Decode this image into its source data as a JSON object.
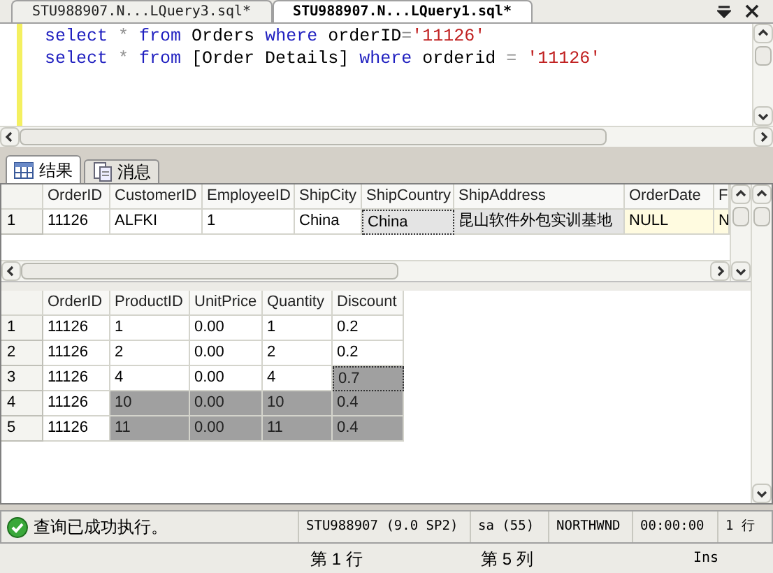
{
  "doc_tabs": [
    {
      "label": "STU988907.N...LQuery3.sql*",
      "selected": false
    },
    {
      "label": "STU988907.N...LQuery1.sql*",
      "selected": true
    }
  ],
  "editor": {
    "lines": [
      [
        {
          "text": "select",
          "kind": "keyword"
        },
        {
          "text": " * ",
          "kind": "operator"
        },
        {
          "text": "from",
          "kind": "keyword"
        },
        {
          "text": " Orders ",
          "kind": "plain"
        },
        {
          "text": "where",
          "kind": "keyword"
        },
        {
          "text": " orderID",
          "kind": "plain"
        },
        {
          "text": "=",
          "kind": "operator"
        },
        {
          "text": "'11126'",
          "kind": "string"
        }
      ],
      [
        {
          "text": "select",
          "kind": "keyword"
        },
        {
          "text": " * ",
          "kind": "operator"
        },
        {
          "text": "from",
          "kind": "keyword"
        },
        {
          "text": " [Order Details] ",
          "kind": "plain"
        },
        {
          "text": "where",
          "kind": "keyword"
        },
        {
          "text": " orderid ",
          "kind": "plain"
        },
        {
          "text": "= ",
          "kind": "operator"
        },
        {
          "text": "'11126'",
          "kind": "string"
        }
      ]
    ]
  },
  "result_tabs": [
    {
      "label": "结果",
      "kind": "grid",
      "selected": true
    },
    {
      "label": "消息",
      "kind": "messages",
      "selected": false
    }
  ],
  "grids": [
    {
      "active": false,
      "columns": [
        "OrderID",
        "CustomerID",
        "EmployeeID",
        "ShipCity",
        "ShipCountry",
        "ShipAddress",
        "OrderDate",
        "F"
      ],
      "rows": [
        {
          "number": "1",
          "cells": [
            {
              "text": "11126",
              "kind": "value",
              "selected": false,
              "focused": false
            },
            {
              "text": "ALFKI",
              "kind": "value",
              "selected": false,
              "focused": false
            },
            {
              "text": "1",
              "kind": "value",
              "selected": false,
              "focused": false
            },
            {
              "text": "China",
              "kind": "value",
              "selected": false,
              "focused": false
            },
            {
              "text": "China",
              "kind": "value",
              "selected": true,
              "focused": true
            },
            {
              "text": "昆山软件外包实训基地",
              "kind": "value",
              "selected": true,
              "focused": false
            },
            {
              "text": "NULL",
              "kind": "null",
              "selected": false,
              "focused": false
            },
            {
              "text": "N",
              "kind": "null",
              "selected": false,
              "focused": false
            }
          ]
        }
      ]
    },
    {
      "active": true,
      "columns": [
        "OrderID",
        "ProductID",
        "UnitPrice",
        "Quantity",
        "Discount"
      ],
      "rows": [
        {
          "number": "1",
          "cells": [
            {
              "text": "11126",
              "selected": false,
              "focused": false
            },
            {
              "text": "1",
              "selected": false,
              "focused": false
            },
            {
              "text": "0.00",
              "selected": false,
              "focused": false
            },
            {
              "text": "1",
              "selected": false,
              "focused": false
            },
            {
              "text": "0.2",
              "selected": false,
              "focused": false
            }
          ]
        },
        {
          "number": "2",
          "cells": [
            {
              "text": "11126",
              "selected": false,
              "focused": false
            },
            {
              "text": "2",
              "selected": false,
              "focused": false
            },
            {
              "text": "0.00",
              "selected": false,
              "focused": false
            },
            {
              "text": "2",
              "selected": false,
              "focused": false
            },
            {
              "text": "0.2",
              "selected": false,
              "focused": false
            }
          ]
        },
        {
          "number": "3",
          "cells": [
            {
              "text": "11126",
              "selected": false,
              "focused": false
            },
            {
              "text": "4",
              "selected": false,
              "focused": false
            },
            {
              "text": "0.00",
              "selected": false,
              "focused": false
            },
            {
              "text": "4",
              "selected": false,
              "focused": false
            },
            {
              "text": "0.7",
              "selected": true,
              "focused": true
            }
          ]
        },
        {
          "number": "4",
          "cells": [
            {
              "text": "11126",
              "selected": false,
              "focused": false
            },
            {
              "text": "10",
              "selected": true,
              "focused": false
            },
            {
              "text": "0.00",
              "selected": true,
              "focused": false
            },
            {
              "text": "10",
              "selected": true,
              "focused": false
            },
            {
              "text": "0.4",
              "selected": true,
              "focused": false
            }
          ]
        },
        {
          "number": "5",
          "cells": [
            {
              "text": "11126",
              "selected": false,
              "focused": false
            },
            {
              "text": "11",
              "selected": true,
              "focused": false
            },
            {
              "text": "0.00",
              "selected": true,
              "focused": false
            },
            {
              "text": "11",
              "selected": true,
              "focused": false
            },
            {
              "text": "0.4",
              "selected": true,
              "focused": false
            }
          ]
        }
      ]
    }
  ],
  "query_status": {
    "message": "查询已成功执行。",
    "server": "STU988907 (9.0 SP2)",
    "user": "sa (55)",
    "database": "NORTHWND",
    "elapsed": "00:00:00",
    "rows": "1 行"
  },
  "status_bar": {
    "line": "第 1 行",
    "column": "第 5 列",
    "mode": "Ins"
  }
}
